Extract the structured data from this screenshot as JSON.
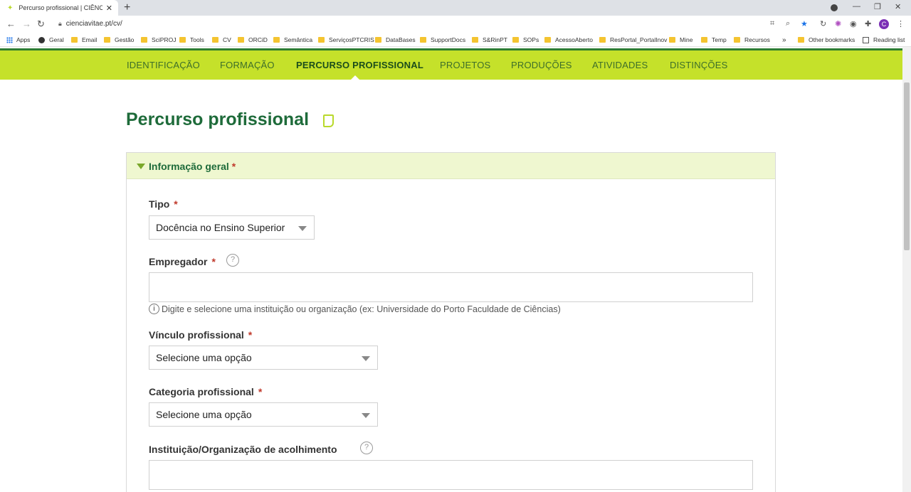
{
  "browser": {
    "tab_title": "Percurso profissional | CIÊNCIAVITAE",
    "url": "cienciavitae.pt/cv/",
    "avatar_initial": "C",
    "bookmarks": [
      "Apps",
      "Geral",
      "Email",
      "Gestão",
      "SciPROJ",
      "Tools",
      "CV",
      "ORCiD",
      "Semântica",
      "ServiçosPTCRIS",
      "DataBases",
      "SupportDocs",
      "S&RinPT",
      "SOPs",
      "AcessoAberto",
      "ResPortal_PortalInov",
      "Mine",
      "Temp",
      "Recursos"
    ],
    "overflow": "»",
    "other_bookmarks": "Other bookmarks",
    "reading_list": "Reading list"
  },
  "nav": {
    "items": [
      "IDENTIFICAÇÃO",
      "FORMAÇÃO",
      "PERCURSO PROFISSIONAL",
      "PROJETOS",
      "PRODUÇÕES",
      "ATIVIDADES",
      "DISTINÇÕES"
    ],
    "active": "PERCURSO PROFISSIONAL"
  },
  "page": {
    "title": "Percurso profissional"
  },
  "section": {
    "title": "Informação geral",
    "required_mark": "*"
  },
  "form": {
    "tipo": {
      "label": "Tipo",
      "value": "Docência no Ensino Superior"
    },
    "empregador": {
      "label": "Empregador",
      "value": "",
      "hint": "Digite e selecione uma instituição ou organização (ex: Universidade do Porto Faculdade de Ciências)"
    },
    "vinculo": {
      "label": "Vínculo profissional",
      "value": "Selecione uma opção"
    },
    "categoria": {
      "label": "Categoria profissional",
      "value": "Selecione uma opção"
    },
    "instituicao": {
      "label": "Instituição/Organização de acolhimento",
      "value": ""
    },
    "help_glyph": "?",
    "info_glyph": "i"
  },
  "colors": {
    "nav_bg": "#c5e12a",
    "title_green": "#1e6b3a",
    "required_red": "#c0392b",
    "section_bg": "#eff7d0"
  }
}
